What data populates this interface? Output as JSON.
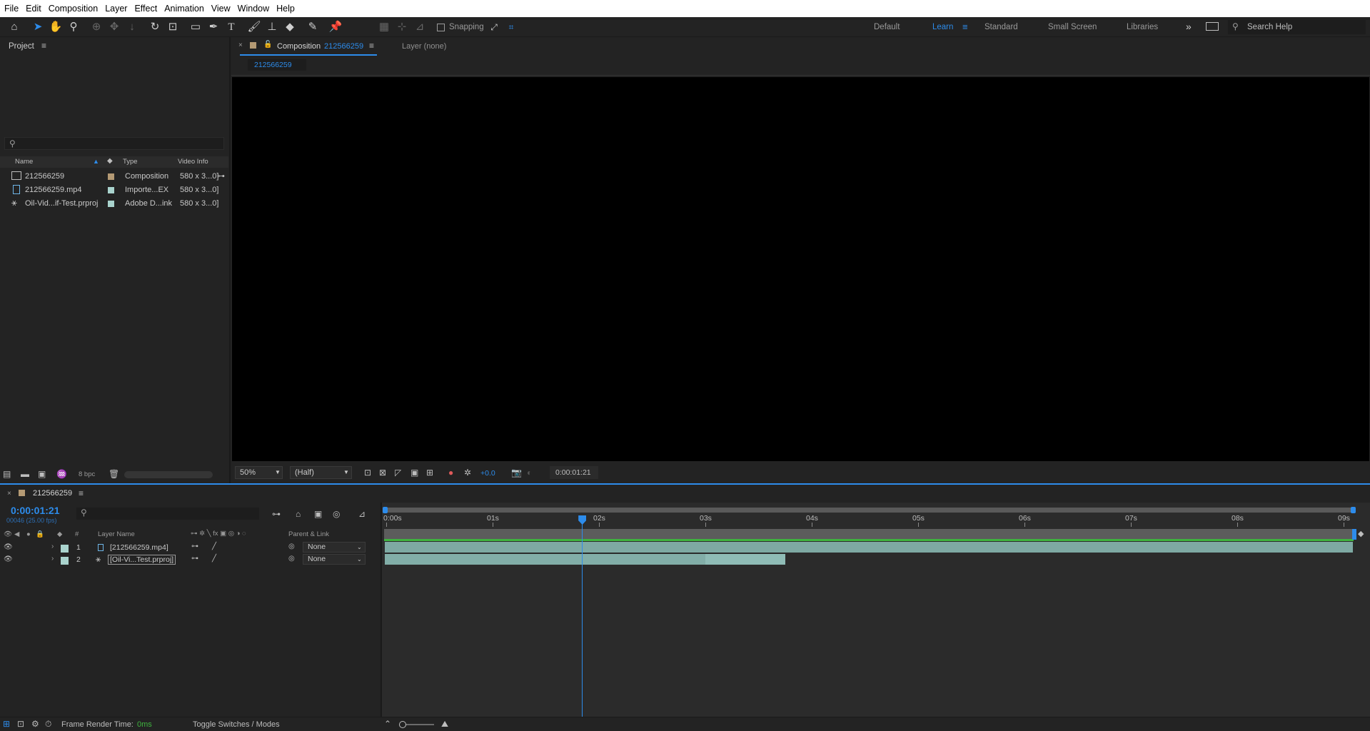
{
  "menu": [
    "File",
    "Edit",
    "Composition",
    "Layer",
    "Effect",
    "Animation",
    "View",
    "Window",
    "Help"
  ],
  "toolbar": {
    "snapping_label": "Snapping",
    "workspaces": [
      "Default",
      "Learn",
      "Standard",
      "Small Screen",
      "Libraries"
    ],
    "active_workspace": "Learn",
    "search_placeholder": "Search Help"
  },
  "project": {
    "title": "Project",
    "columns": {
      "name": "Name",
      "type": "Type",
      "video_info": "Video Info"
    },
    "items": [
      {
        "name": "212566259",
        "type": "Composition",
        "info": "580 x 3...0]",
        "color": "#b49a74",
        "icon": "composition-icon"
      },
      {
        "name": "212566259.mp4",
        "type": "Importe...EX",
        "info": "580 x 3...0]",
        "color": "#a9d3cd",
        "icon": "video-file-icon"
      },
      {
        "name": "Oil-Vid...if-Test.prproj",
        "type": "Adobe D...ink",
        "info": "580 x 3...0]",
        "color": "#a9d3cd",
        "icon": "dynamic-link-icon"
      }
    ],
    "bpc": "8 bpc"
  },
  "composition_panel": {
    "tab_prefix": "Composition",
    "tab_name": "212566259",
    "layer_tab": "Layer (none)",
    "breadcrumb": "212566259",
    "zoom": "50%",
    "resolution": "(Half)",
    "exposure": "+0.0",
    "timecode": "0:00:01:21"
  },
  "timeline": {
    "comp_name": "212566259",
    "timecode": "0:00:01:21",
    "frame_info": "00046 (25.00 fps)",
    "layer_name_header": "Layer Name",
    "parent_header": "Parent & Link",
    "ruler": [
      "0:00s",
      "01s",
      "02s",
      "03s",
      "04s",
      "05s",
      "06s",
      "07s",
      "08s",
      "09s"
    ],
    "layers": [
      {
        "num": "1",
        "name": "[212566259.mp4]",
        "parent": "None"
      },
      {
        "num": "2",
        "name": "[Oil-Vi...Test.prproj]",
        "parent": "None"
      }
    ],
    "playhead_seconds": 1.84,
    "layer2_end_seconds": 3.75
  },
  "status": {
    "render_label": "Frame Render Time:",
    "render_value": "0ms",
    "toggle_label": "Toggle Switches / Modes"
  }
}
